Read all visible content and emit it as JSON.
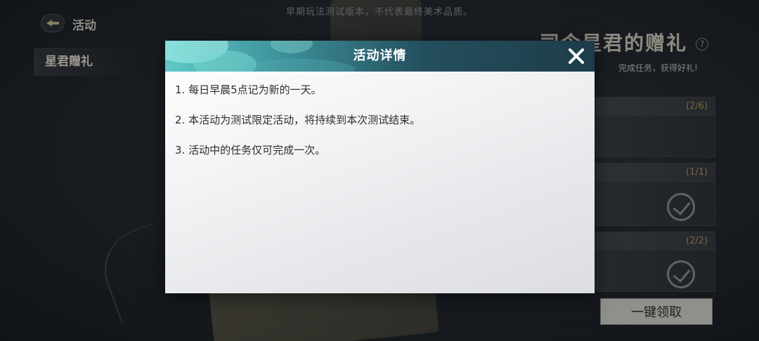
{
  "watermark": "早期玩法测试版本，不代表最终美术品质。",
  "nav": {
    "back_icon": "back-arrow-icon",
    "title": "活动",
    "tabs": [
      {
        "label": "星君赠礼"
      }
    ]
  },
  "event": {
    "title": "司令星君的赠礼",
    "help_icon": "question-mark-icon",
    "subtitle": "完成任务，获得好礼!",
    "tasks": [
      {
        "progress": "(2/6)",
        "completed": false
      },
      {
        "progress": "(1/1)",
        "completed": true
      },
      {
        "progress": "(2/2)",
        "completed": true
      }
    ],
    "claim_all_label": "一键领取"
  },
  "modal": {
    "title": "活动详情",
    "close_icon": "close-x-icon",
    "rules": [
      "1. 每日早晨5点记为新的一天。",
      "2. 本活动为测试限定活动，将持续到本次测试结束。",
      "3. 活动中的任务仅可完成一次。"
    ]
  },
  "colors": {
    "header_teal": "#3c8f98",
    "header_dark": "#1e3c4a",
    "progress_gold": "#b89a56",
    "modal_bg": "#f4f4f6"
  }
}
